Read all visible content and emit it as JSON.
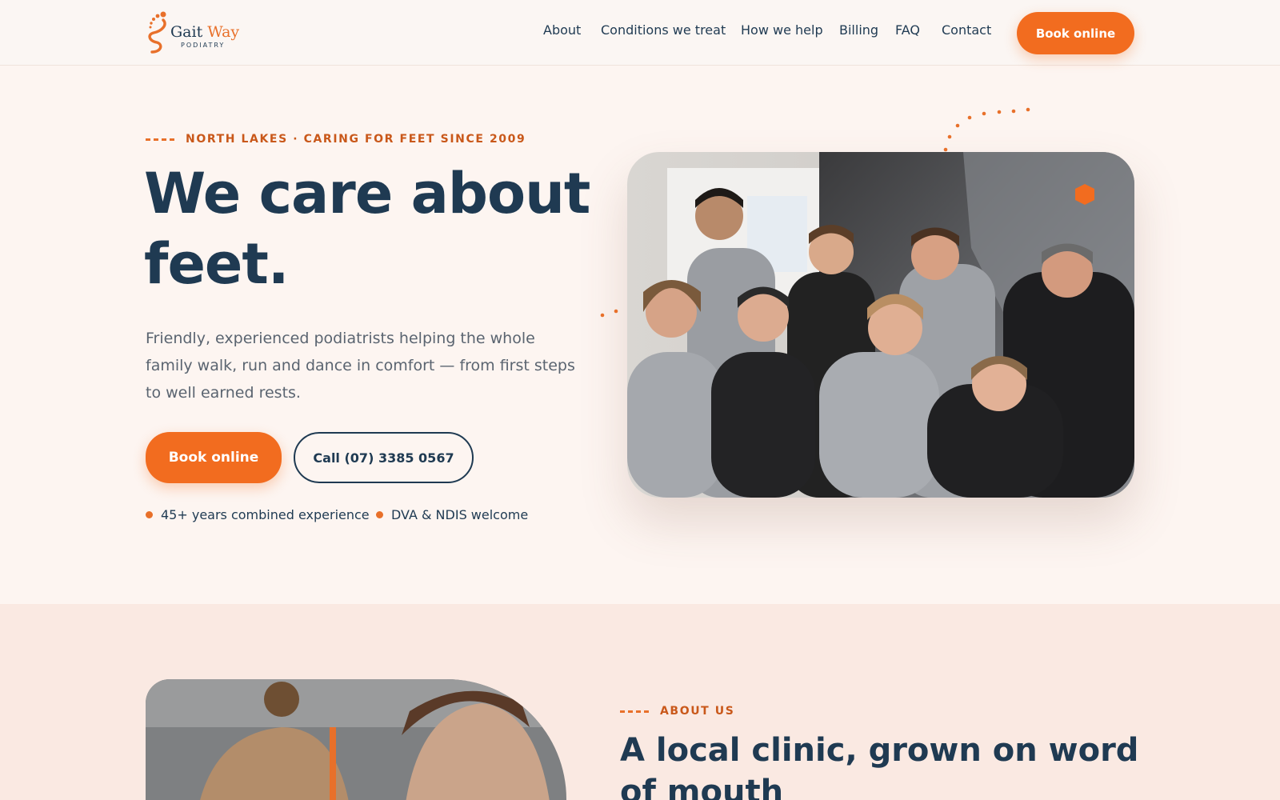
{
  "brand": {
    "name_part1": "Gait",
    "name_part2": "Way",
    "subtitle": "PODIATRY"
  },
  "nav": {
    "items": [
      "About",
      "Conditions we treat",
      "How we help",
      "Billing",
      "FAQ",
      "Contact"
    ],
    "book_label": "Book online"
  },
  "hero": {
    "eyebrow": "NORTH LAKES · CARING FOR FEET SINCE 2009",
    "title": "We care about feet.",
    "description": "Friendly, experienced podiatrists helping the whole family walk, run and dance in comfort — from first steps to well earned rests.",
    "book_label": "Book online",
    "call_label": "Call (07) 3385 0567",
    "trust": [
      "45+ years combined experience",
      "DVA & NDIS welcome"
    ]
  },
  "about": {
    "eyebrow": "ABOUT US",
    "title": "A local clinic, grown on word of mouth"
  },
  "colors": {
    "accent": "#f26c1f",
    "navy": "#1f3a52",
    "background": "#fdf5f1",
    "section_alt": "#fae9e2"
  },
  "icons": {
    "logo": "footprint-logo-icon"
  }
}
